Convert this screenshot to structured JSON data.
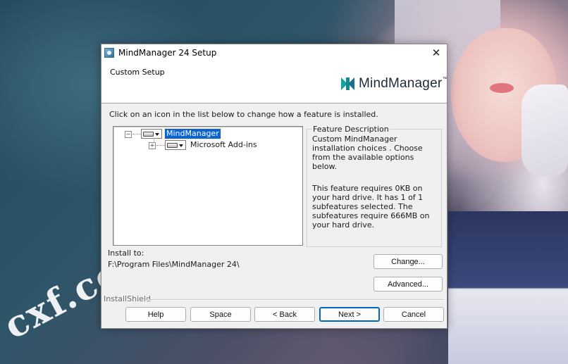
{
  "window": {
    "title": "MindManager 24 Setup",
    "close_glyph": "✕",
    "icon": "installer-icon"
  },
  "header": {
    "title": "Custom Setup",
    "logo_text": "MindManager",
    "logo_tm": "™",
    "brand_colors": [
      "#17a39b",
      "#1b6f8f"
    ]
  },
  "instructions": "Click on an icon in the list below to change how a feature is installed.",
  "feature_tree": [
    {
      "label": "MindManager",
      "expander": "−",
      "selected": true,
      "icon": "hard-drive-icon"
    },
    {
      "label": "Microsoft Add-ins",
      "expander": "+",
      "selected": false,
      "icon": "hard-drive-icon"
    }
  ],
  "feature_description": {
    "legend": "Feature Description",
    "description": "Custom MindManager installation choices . Choose from the available options below.",
    "requirements": "This feature requires 0KB on your hard drive. It has 1 of 1 subfeatures selected. The subfeatures require 666MB on your hard drive."
  },
  "install_to": {
    "label": "Install to:",
    "path": "F:\\Program Files\\MindManager 24\\"
  },
  "buttons": {
    "change": "Change...",
    "advanced": "Advanced...",
    "help": "Help",
    "space": "Space",
    "back": "< Back",
    "next": "Next >",
    "cancel": "Cancel"
  },
  "footer": {
    "brand": "InstallShield"
  },
  "desktop": {
    "watermark": "cxf.co"
  },
  "colors": {
    "selection": "#0a64d6",
    "default_button_border": "#0067c0"
  }
}
